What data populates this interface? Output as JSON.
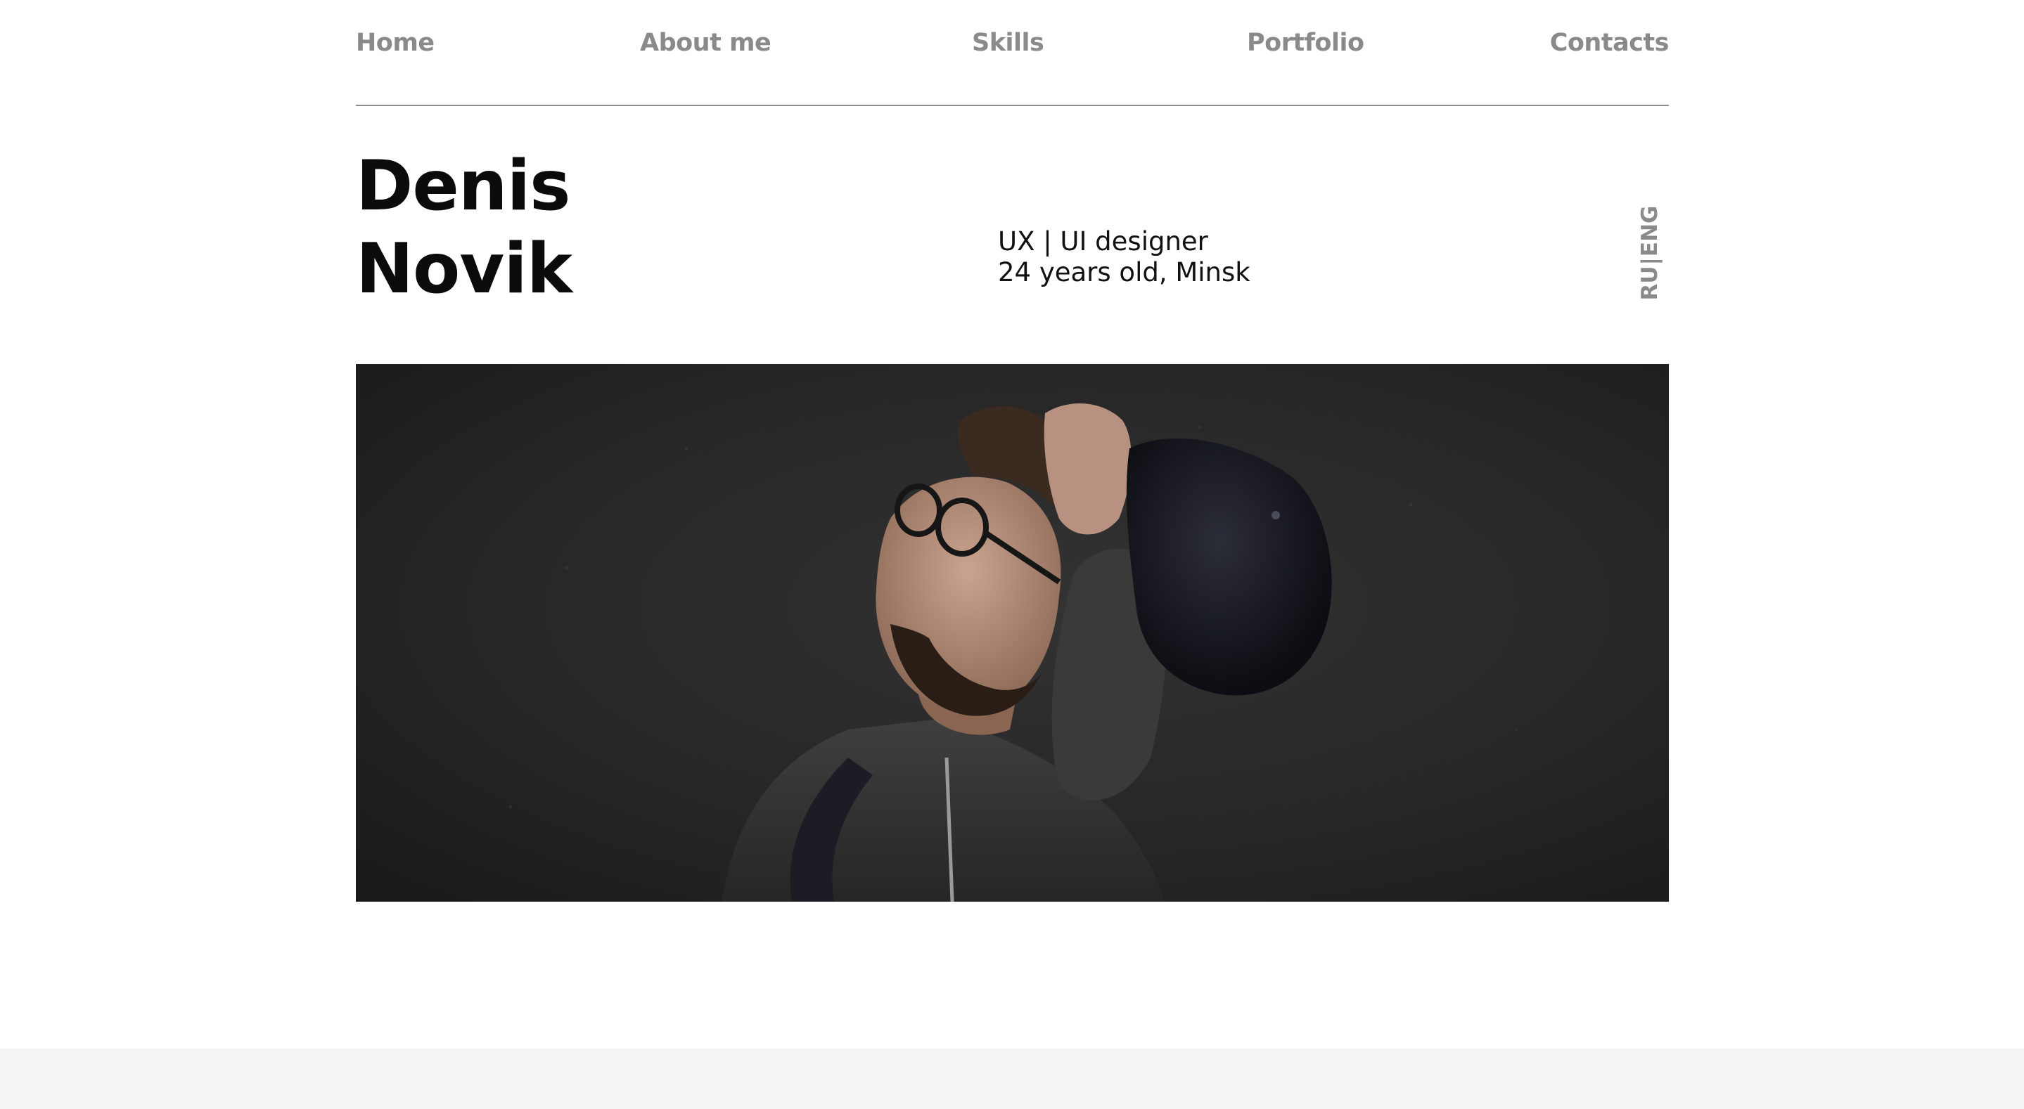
{
  "nav": {
    "items": [
      "Home",
      "About me",
      "Skills",
      "Portfolio",
      "Contacts"
    ]
  },
  "hero": {
    "first_name": "Denis",
    "last_name": "Novik",
    "role": "UX | UI designer",
    "meta": "24 years old, Minsk"
  },
  "language": {
    "ru": "RU",
    "separator": "|",
    "eng": "ENG"
  },
  "colors": {
    "nav_text": "#8a8a8a",
    "heading": "#0b0b0b",
    "divider": "#8c8c8c",
    "footer_band": "#f4f4f4"
  }
}
